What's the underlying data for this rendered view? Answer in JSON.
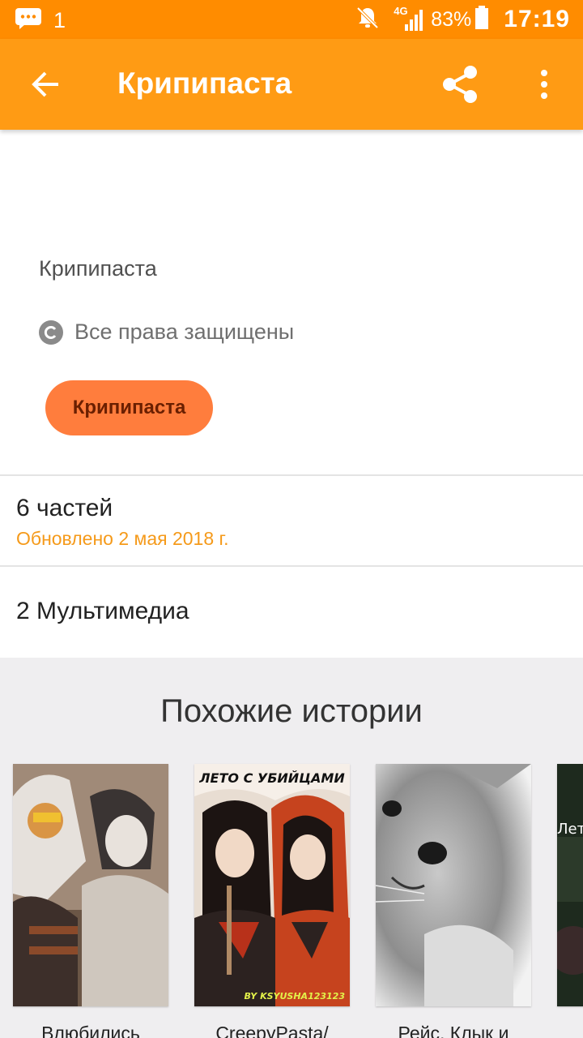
{
  "status_bar": {
    "notification_count": "1",
    "network": "4G",
    "battery": "83%",
    "time": "17:19"
  },
  "app_bar": {
    "title": "Крипипаста",
    "icons": [
      "back-arrow-icon",
      "share-icon",
      "more-vert-icon"
    ]
  },
  "story": {
    "description": "Крипипаста",
    "copyright": "Все права защищены",
    "tag": "Крипипаста",
    "parts": "6 частей",
    "updated": "Обновлено 2 мая 2018 г.",
    "media": "2 Мультимедиа"
  },
  "similar": {
    "heading": "Похожие истории",
    "items": [
      {
        "title": "Влюбились"
      },
      {
        "title": "CreepyPasta/",
        "cover_text_top": "ЛЕТО С УБИЙЦАМИ",
        "cover_text_bottom": "BY KSYUSHA123123"
      },
      {
        "title": "Рейс, Клык и"
      },
      {
        "title": "",
        "cover_text_top": "Лето"
      }
    ]
  },
  "colors": {
    "status_bar": "#ff8c00",
    "app_bar": "#ff9b14",
    "tag_chip": "#ff7d3d",
    "updated_text": "#f59a1a",
    "similar_bg": "#efeef0"
  }
}
